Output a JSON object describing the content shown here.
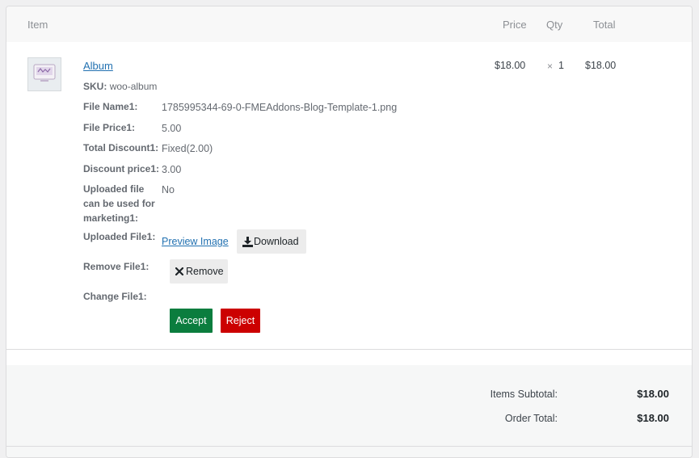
{
  "table": {
    "headers": {
      "item": "Item",
      "price": "Price",
      "qty": "Qty",
      "total": "Total"
    }
  },
  "line_item": {
    "thumbnail_icon": "product-placeholder-icon",
    "name": "Album",
    "sku_label": "SKU:",
    "sku_value": "woo-album",
    "price": "$18.00",
    "qty_symbol": "×",
    "qty": "1",
    "total": "$18.00",
    "meta": [
      {
        "label": "File Name1:",
        "value": "1785995344-69-0-FMEAddons-Blog-Template-1.png"
      },
      {
        "label": "File Price1:",
        "value": "5.00"
      },
      {
        "label": "Total Discount1:",
        "value": "Fixed(2.00)"
      },
      {
        "label": "Discount price1:",
        "value": "3.00"
      },
      {
        "label": "Uploaded file can be used for marketing1:",
        "value": "No"
      },
      {
        "label": "Uploaded File1:",
        "value": ""
      },
      {
        "label": "Remove File1:",
        "value": ""
      },
      {
        "label": "Change File1:",
        "value": ""
      }
    ],
    "preview_link": "Preview Image",
    "download_label": "Download",
    "remove_label": "Remove",
    "accept_label": "Accept",
    "reject_label": "Reject"
  },
  "totals": {
    "subtotal_label": "Items Subtotal:",
    "subtotal_value": "$18.00",
    "order_total_label": "Order Total:",
    "order_total_value": "$18.00"
  },
  "colors": {
    "accept": "#0b7d3e",
    "reject": "#cc0000",
    "link": "#2271b1"
  }
}
